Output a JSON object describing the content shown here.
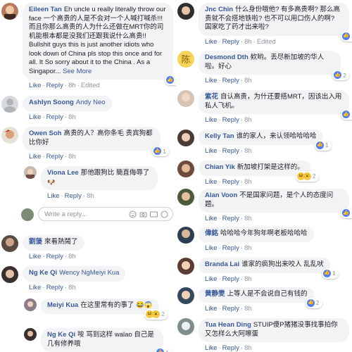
{
  "ui": {
    "like": "Like",
    "reply": "Reply",
    "dot": "·",
    "edited": "Edited",
    "see_more": "See More",
    "reply_placeholder": "Write a reply..."
  },
  "left": [
    {
      "name": "Eileen Tan",
      "text": "Eh uncle u really literally throw our face 一个高贵的人是不会对一个人喊打喊杀!!! 而且你那么高贵的人为什么还做在MRT你的司机能根本都是没我们还跟我说什么高贵!! Bullshit guys this is just another idiots who look down of China pls stop this once and for all. It So sorry about it to the China . As a Singapor...",
      "time": "8h",
      "reactions": "3"
    },
    {
      "name": "Ashlyn Soong",
      "text": "Andy Neo",
      "time": "8h"
    },
    {
      "name": "Owen Soh",
      "text": "高贵的人？高你条毛 贵宾狗都比你好",
      "time": "8h",
      "reactions": "1"
    },
    {
      "name": "Viona Lee",
      "text": "那他跟狗比 簡直侮辱了",
      "time": "8h"
    },
    {
      "name": "劉蔆",
      "text": "來看熱鬧了",
      "time": "8h"
    },
    {
      "name": "Ng Ke Qi",
      "text": "Wency NgMeiyi Kua",
      "time": "8h"
    },
    {
      "name": "Meiyi Kua",
      "text": "在这里常有的事了",
      "reactions": "2"
    },
    {
      "name": "Ng Ke Qi",
      "text": "咹 骂到这样 walao 自己是几有修养哦",
      "reactions": "1"
    }
  ],
  "right": [
    {
      "name": "Jnc Chin",
      "text": "什么身份哦他? 有多高贵啊? 那么高贵就不会搭地铁啦? 也不可以用口伤人的啊? 国家吃了药才出来啦?",
      "time": "8h",
      "reactions": "2"
    },
    {
      "name": "Desmond Dth",
      "text": "欸哟。丢尽新加坡的华人啦。好心",
      "time": "8h",
      "reactions": "2"
    },
    {
      "name": "紫花",
      "text": "自认高贵，为什还要搭MRT，因该出入用私人飞机。",
      "time": "8h",
      "reactions": "1"
    },
    {
      "name": "Kelly Tan",
      "text": "谁的家人，来认领哈哈哈哈",
      "time": "8h",
      "reactions": "1"
    },
    {
      "name": "Chian Yik",
      "text": "新加坡打架是这样的。",
      "time": "8h",
      "reactions": "2"
    },
    {
      "name": "Alan Voon",
      "text": "不是国家问题，是个人的态度问题。",
      "time": "8h",
      "reactions": "1"
    },
    {
      "name": "偉銘",
      "text": "哈哈哈今年狗年啊老板哈哈哈",
      "time": "8h"
    },
    {
      "name": "Branda Lai",
      "text": "谁家的疯狗出来咬人 乱乱吠",
      "time": "8h",
      "reactions": "1"
    },
    {
      "name": "黄静雯",
      "text": "上等人是不会说自己有钱的",
      "time": "8h",
      "reactions": "2"
    },
    {
      "name": "Tua Hean Ding",
      "text": "STUIP傻P猪猪没事找事拍你又怎样么大阿嚓蛋",
      "time": "8h"
    }
  ]
}
